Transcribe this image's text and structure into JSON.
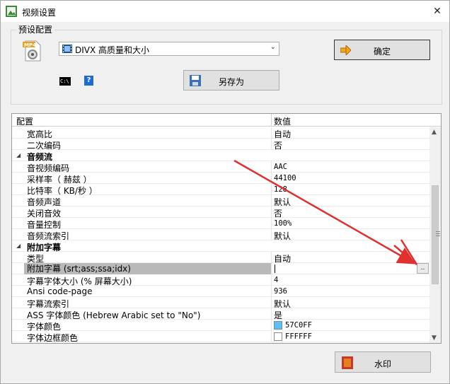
{
  "window": {
    "title": "视频设置"
  },
  "preset": {
    "group_label": "预设配置",
    "selected_value": "DIVX 高质量和大小",
    "ok_label": "确定",
    "save_as_label": "另存为",
    "mp4_badge": "MP4",
    "cmd_icon_text": "C:\\"
  },
  "grid": {
    "header_name": "配置",
    "header_value": "数值",
    "rows": [
      {
        "key": "宽高比",
        "value": "自动"
      },
      {
        "key": "二次编码",
        "value": "否"
      },
      {
        "key": "音频流",
        "category": true
      },
      {
        "key": "音视频编码",
        "value": "AAC"
      },
      {
        "key": "采样率（ 赫兹 ）",
        "value": "44100"
      },
      {
        "key": "比特率（ KB/秒 ）",
        "value": "128"
      },
      {
        "key": "音频声道",
        "value": "默认"
      },
      {
        "key": "关闭音效",
        "value": "否"
      },
      {
        "key": "音量控制",
        "value": "100%"
      },
      {
        "key": "音频流索引",
        "value": "默认"
      },
      {
        "key": "附加字幕",
        "category": true
      },
      {
        "key": "类型",
        "value": "自动"
      },
      {
        "key": "附加字幕 (srt;ass;ssa;idx)",
        "value": "",
        "selected": true
      },
      {
        "key": "字幕字体大小 (% 屏幕大小)",
        "value": "4"
      },
      {
        "key": "Ansi code-page",
        "value": "936"
      },
      {
        "key": "字幕流索引",
        "value": "默认"
      },
      {
        "key": "ASS 字体颜色 (Hebrew Arabic set to \"No\")",
        "value": "是"
      },
      {
        "key": "字体颜色",
        "value": "57C0FF",
        "swatch": "#57c0ff"
      },
      {
        "key": "字体边框颜色",
        "value": "FFFFFF",
        "swatch": "#ffffff"
      }
    ],
    "ellipsis_label": ".."
  },
  "footer": {
    "watermark_label": "水印"
  },
  "colors": {
    "accent_arrow": "#e03030",
    "selected_row": "#b9b9b9"
  }
}
